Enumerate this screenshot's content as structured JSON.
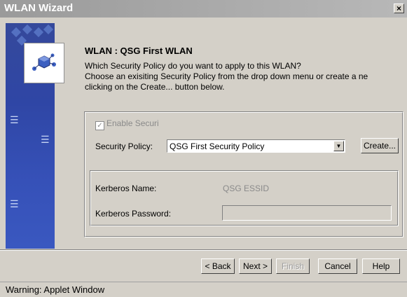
{
  "window": {
    "title": "WLAN Wizard",
    "close_glyph": "×"
  },
  "header": {
    "title": "WLAN :  QSG First WLAN",
    "line1": "Which Security Policy do you want to apply to this WLAN?",
    "line2": "Choose an exisiting Security Policy from the drop down menu or create a ne",
    "line3": "clicking on the Create... button below."
  },
  "security": {
    "enable_label": "Enable Securi",
    "enable_checked": true,
    "policy_label": "Security Policy:",
    "policy_value": "QSG First Security Policy",
    "create_label": "Create..."
  },
  "kerberos": {
    "name_label": "Kerberos Name:",
    "name_value": "QSG ESSID",
    "password_label": "Kerberos Password:",
    "password_value": ""
  },
  "buttons": {
    "back": "< Back",
    "next": "Next >",
    "finish": "Finish",
    "cancel": "Cancel",
    "help": "Help"
  },
  "status_bar": {
    "text": "Warning: Applet Window"
  },
  "icons": {
    "wizard": "network-cubes-icon",
    "wifi": "wifi-signal-icon",
    "dropdown": "chevron-down-icon"
  }
}
